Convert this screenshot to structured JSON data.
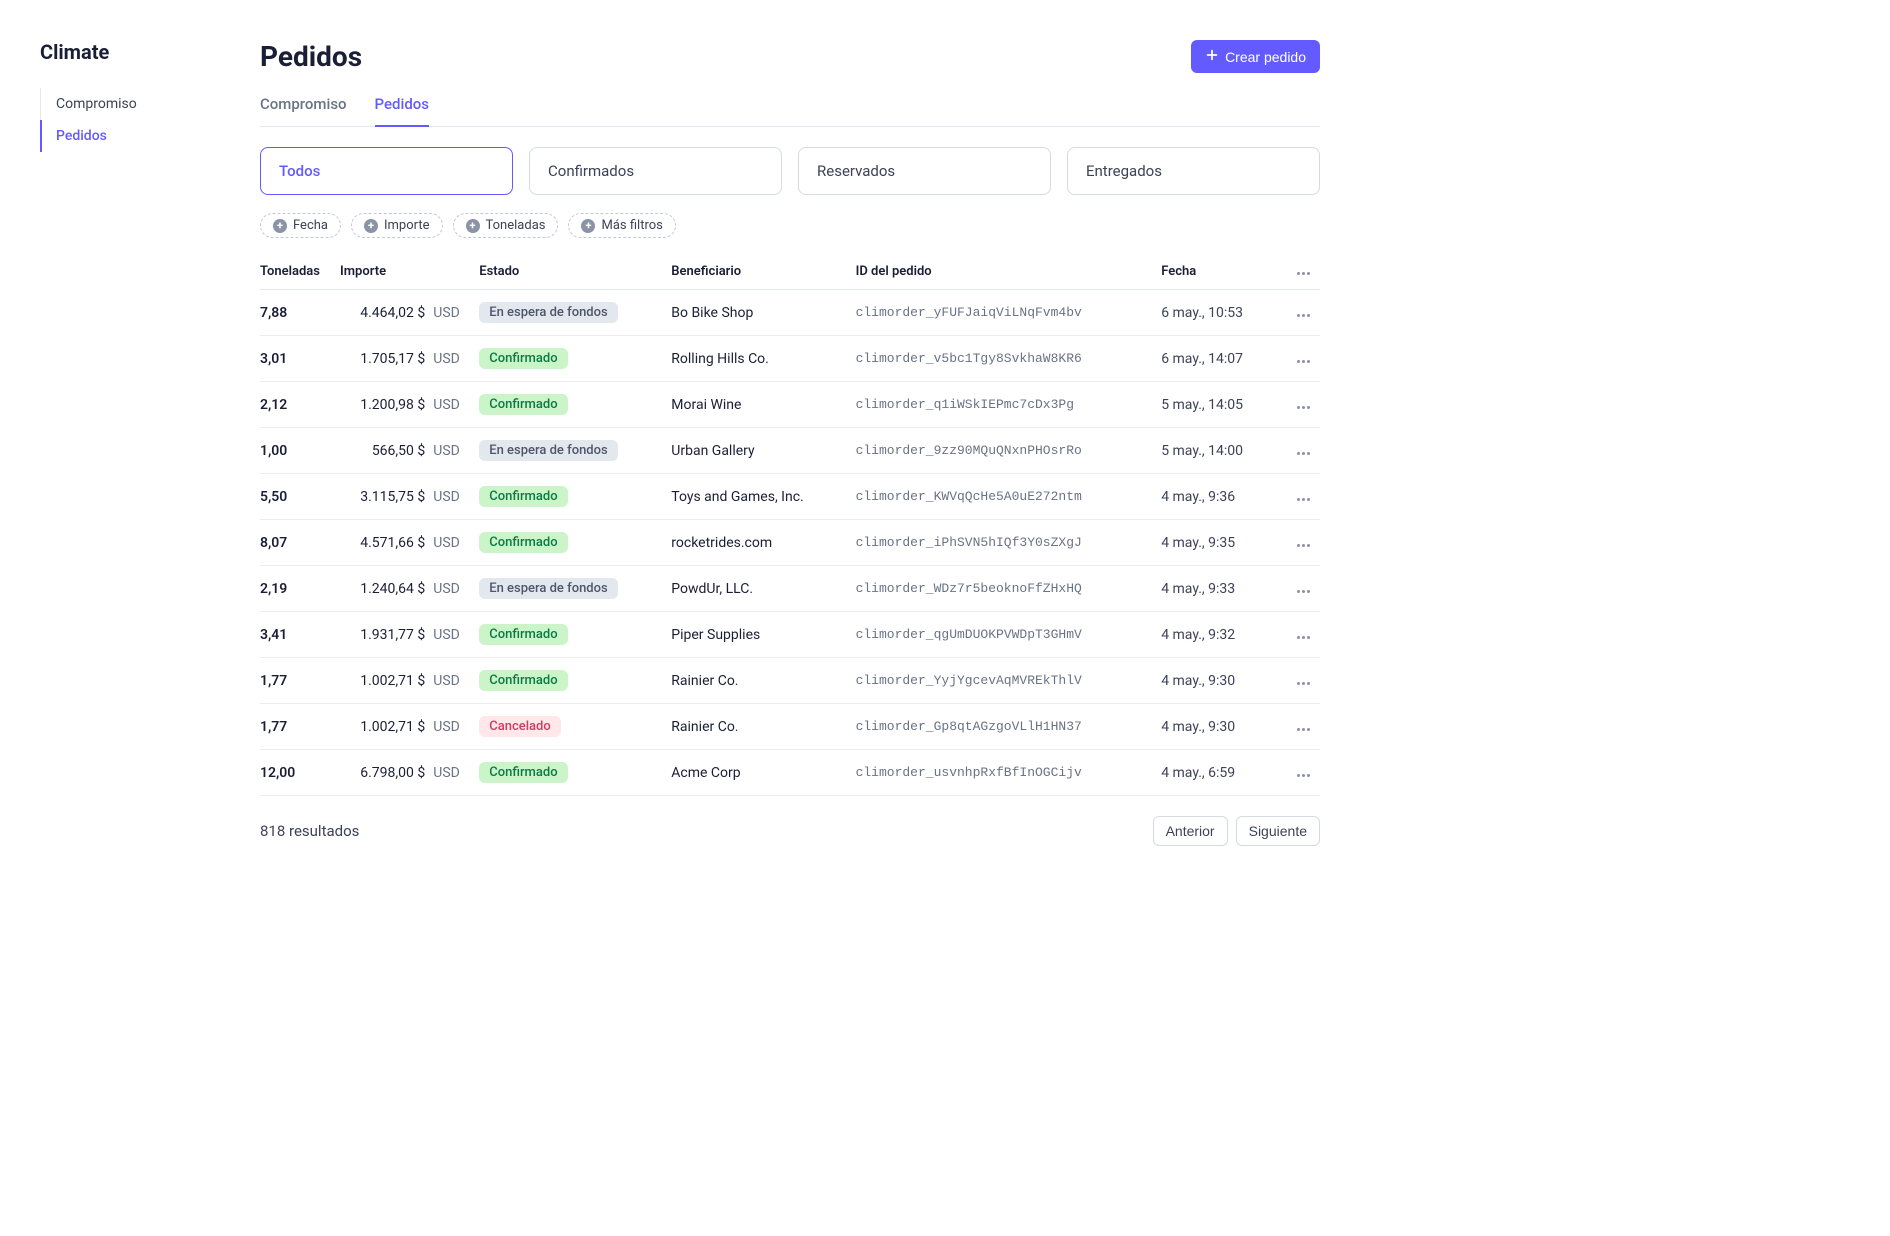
{
  "sidebar": {
    "title": "Climate",
    "items": [
      {
        "label": "Compromiso",
        "active": false
      },
      {
        "label": "Pedidos",
        "active": true
      }
    ]
  },
  "header": {
    "title": "Pedidos",
    "create_button": "Crear pedido"
  },
  "tabs": [
    {
      "label": "Compromiso",
      "active": false
    },
    {
      "label": "Pedidos",
      "active": true
    }
  ],
  "status_filters": [
    {
      "label": "Todos",
      "active": true
    },
    {
      "label": "Confirmados",
      "active": false
    },
    {
      "label": "Reservados",
      "active": false
    },
    {
      "label": "Entregados",
      "active": false
    }
  ],
  "filter_chips": [
    {
      "label": "Fecha"
    },
    {
      "label": "Importe"
    },
    {
      "label": "Toneladas"
    },
    {
      "label": "Más filtros"
    }
  ],
  "table": {
    "columns": {
      "toneladas": "Toneladas",
      "importe": "Importe",
      "estado": "Estado",
      "beneficiario": "Beneficiario",
      "id": "ID del pedido",
      "fecha": "Fecha"
    },
    "status_labels": {
      "awaiting": "En espera de fondos",
      "confirmed": "Confirmado",
      "canceled": "Cancelado"
    },
    "rows": [
      {
        "ton": "7,88",
        "amount": "4.464,02 $",
        "currency": "USD",
        "status": "awaiting",
        "beneficiary": "Bo Bike Shop",
        "order_id": "climorder_yFUFJaiqViLNqFvm4bv",
        "date": "6 may., 10:53"
      },
      {
        "ton": "3,01",
        "amount": "1.705,17 $",
        "currency": "USD",
        "status": "confirmed",
        "beneficiary": "Rolling Hills Co.",
        "order_id": "climorder_v5bc1Tgy8SvkhaW8KR6",
        "date": "6 may., 14:07"
      },
      {
        "ton": "2,12",
        "amount": "1.200,98 $",
        "currency": "USD",
        "status": "confirmed",
        "beneficiary": "Morai Wine",
        "order_id": "climorder_q1iWSkIEPmc7cDx3Pg",
        "date": "5 may., 14:05"
      },
      {
        "ton": "1,00",
        "amount": "566,50 $",
        "currency": "USD",
        "status": "awaiting",
        "beneficiary": "Urban Gallery",
        "order_id": "climorder_9zz90MQuQNxnPHOsrRo",
        "date": "5 may., 14:00"
      },
      {
        "ton": "5,50",
        "amount": "3.115,75 $",
        "currency": "USD",
        "status": "confirmed",
        "beneficiary": "Toys and Games, Inc.",
        "order_id": "climorder_KWVqQcHe5A0uE272ntm",
        "date": "4 may., 9:36"
      },
      {
        "ton": "8,07",
        "amount": "4.571,66 $",
        "currency": "USD",
        "status": "confirmed",
        "beneficiary": "rocketrides.com",
        "order_id": "climorder_iPhSVN5hIQf3Y0sZXgJ",
        "date": "4 may., 9:35"
      },
      {
        "ton": "2,19",
        "amount": "1.240,64 $",
        "currency": "USD",
        "status": "awaiting",
        "beneficiary": "PowdUr, LLC.",
        "order_id": "climorder_WDz7r5beoknoFfZHxHQ",
        "date": "4 may., 9:33"
      },
      {
        "ton": "3,41",
        "amount": "1.931,77 $",
        "currency": "USD",
        "status": "confirmed",
        "beneficiary": "Piper Supplies",
        "order_id": "climorder_qgUmDUOKPVWDpT3GHmV",
        "date": "4 may., 9:32"
      },
      {
        "ton": "1,77",
        "amount": "1.002,71 $",
        "currency": "USD",
        "status": "confirmed",
        "beneficiary": "Rainier Co.",
        "order_id": "climorder_YyjYgcevAqMVREkThlV",
        "date": "4 may., 9:30"
      },
      {
        "ton": "1,77",
        "amount": "1.002,71 $",
        "currency": "USD",
        "status": "canceled",
        "beneficiary": "Rainier Co.",
        "order_id": "climorder_Gp8qtAGzgoVLlH1HN37",
        "date": "4 may., 9:30"
      },
      {
        "ton": "12,00",
        "amount": "6.798,00 $",
        "currency": "USD",
        "status": "confirmed",
        "beneficiary": "Acme Corp",
        "order_id": "climorder_usvnhpRxfBfInOGCijv",
        "date": "4 may., 6:59"
      }
    ]
  },
  "footer": {
    "results_count": "818 resultados",
    "prev": "Anterior",
    "next": "Siguiente"
  }
}
